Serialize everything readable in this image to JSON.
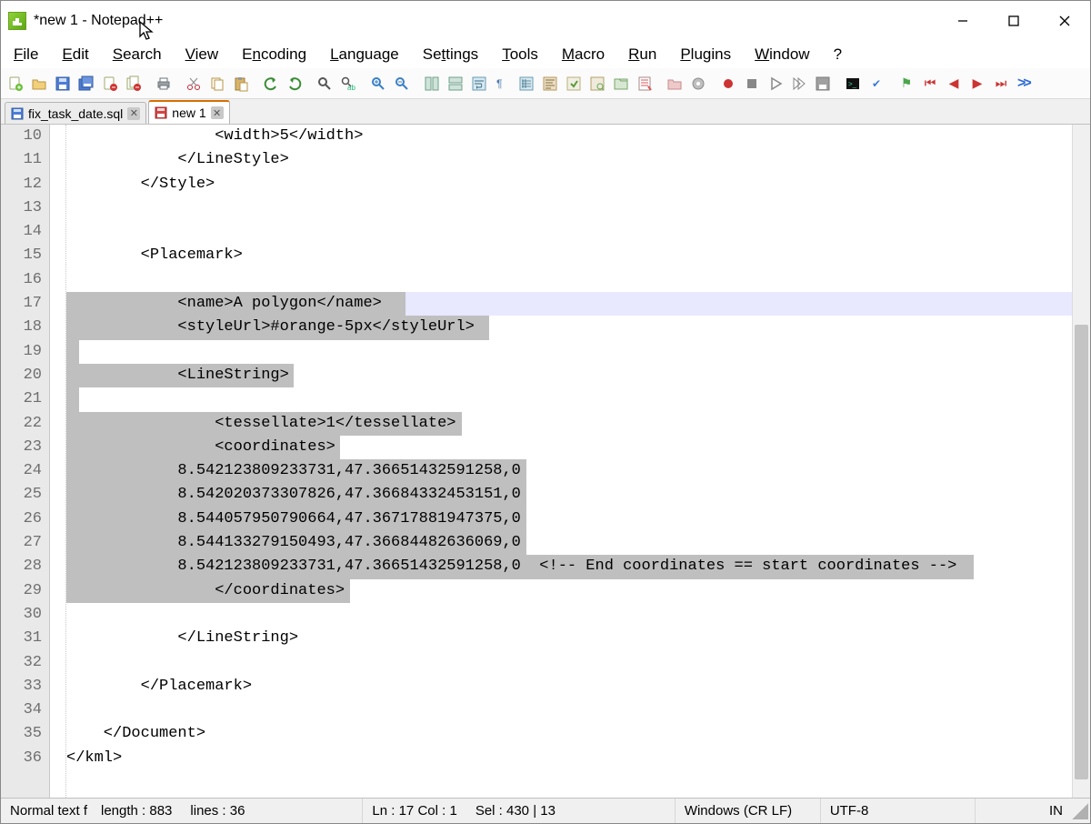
{
  "titlebar": {
    "title": "*new 1 - Notepad++"
  },
  "menubar": {
    "items": [
      {
        "ul": "F",
        "rest": "ile"
      },
      {
        "ul": "E",
        "rest": "dit"
      },
      {
        "ul": "S",
        "rest": "earch"
      },
      {
        "ul": "V",
        "rest": "iew"
      },
      {
        "ul": "",
        "rest": "Encoding",
        "pre": "",
        "ulpos": 0,
        "text": "Encoding",
        "u": "E"
      },
      {
        "ul": "L",
        "rest": "anguage"
      },
      {
        "ul": "",
        "rest": "Settings",
        "u": "t",
        "pre": "Se",
        "post": "tings"
      },
      {
        "ul": "T",
        "rest": "ools"
      },
      {
        "ul": "M",
        "rest": "acro"
      },
      {
        "ul": "R",
        "rest": "un"
      },
      {
        "ul": "P",
        "rest": "lugins"
      },
      {
        "ul": "W",
        "rest": "indow"
      },
      {
        "ul": "?",
        "rest": ""
      }
    ]
  },
  "tabs": [
    {
      "label": "fix_task_date.sql",
      "active": false,
      "saved": true
    },
    {
      "label": "new 1",
      "active": true,
      "saved": false
    }
  ],
  "editor": {
    "first_line_no": 10,
    "lines": [
      {
        "text": "                <width>5</width>",
        "sel": null
      },
      {
        "text": "            </LineStyle>",
        "sel": null
      },
      {
        "text": "        </Style>",
        "sel": null
      },
      {
        "text": "",
        "sel": null
      },
      {
        "text": "",
        "sel": null
      },
      {
        "text": "        <Placemark>",
        "sel": null
      },
      {
        "text": "",
        "sel": null
      },
      {
        "text": "            <name>A polygon</name>",
        "sel": [
          0,
          36
        ],
        "current": true
      },
      {
        "text": "            <styleUrl>#orange-5px</styleUrl>",
        "sel": [
          0,
          45
        ]
      },
      {
        "text": "",
        "sel": [
          0,
          0
        ]
      },
      {
        "text": "            <LineString>",
        "sel": [
          0,
          24
        ]
      },
      {
        "text": "",
        "sel": [
          0,
          0
        ]
      },
      {
        "text": "                <tessellate>1</tessellate>",
        "sel": [
          0,
          42
        ]
      },
      {
        "text": "                <coordinates>",
        "sel": [
          0,
          29
        ]
      },
      {
        "text": "            8.542123809233731,47.36651432591258,0",
        "sel": [
          0,
          49
        ]
      },
      {
        "text": "            8.542020373307826,47.36684332453151,0",
        "sel": [
          0,
          49
        ]
      },
      {
        "text": "            8.544057950790664,47.36717881947375,0",
        "sel": [
          0,
          49
        ]
      },
      {
        "text": "            8.544133279150493,47.36684482636069,0",
        "sel": [
          0,
          49
        ]
      },
      {
        "text": "            8.542123809233731,47.36651432591258,0  <!-- End coordinates == start coordinates -->",
        "sel": [
          0,
          97
        ]
      },
      {
        "text": "                </coordinates>",
        "sel": [
          0,
          30
        ]
      },
      {
        "text": "",
        "sel": null
      },
      {
        "text": "            </LineString>",
        "sel": null
      },
      {
        "text": "",
        "sel": null
      },
      {
        "text": "        </Placemark>",
        "sel": null
      },
      {
        "text": "",
        "sel": null
      },
      {
        "text": "    </Document>",
        "sel": null
      },
      {
        "text": "</kml>",
        "sel": null
      }
    ]
  },
  "statusbar": {
    "file_type": "Normal text f",
    "length_label": "length : 883",
    "lines_label": "lines : 36",
    "pos": "Ln : 17    Col : 1",
    "sel": "Sel : 430 | 13",
    "eol": "Windows (CR LF)",
    "encoding": "UTF-8",
    "mode": "IN"
  }
}
